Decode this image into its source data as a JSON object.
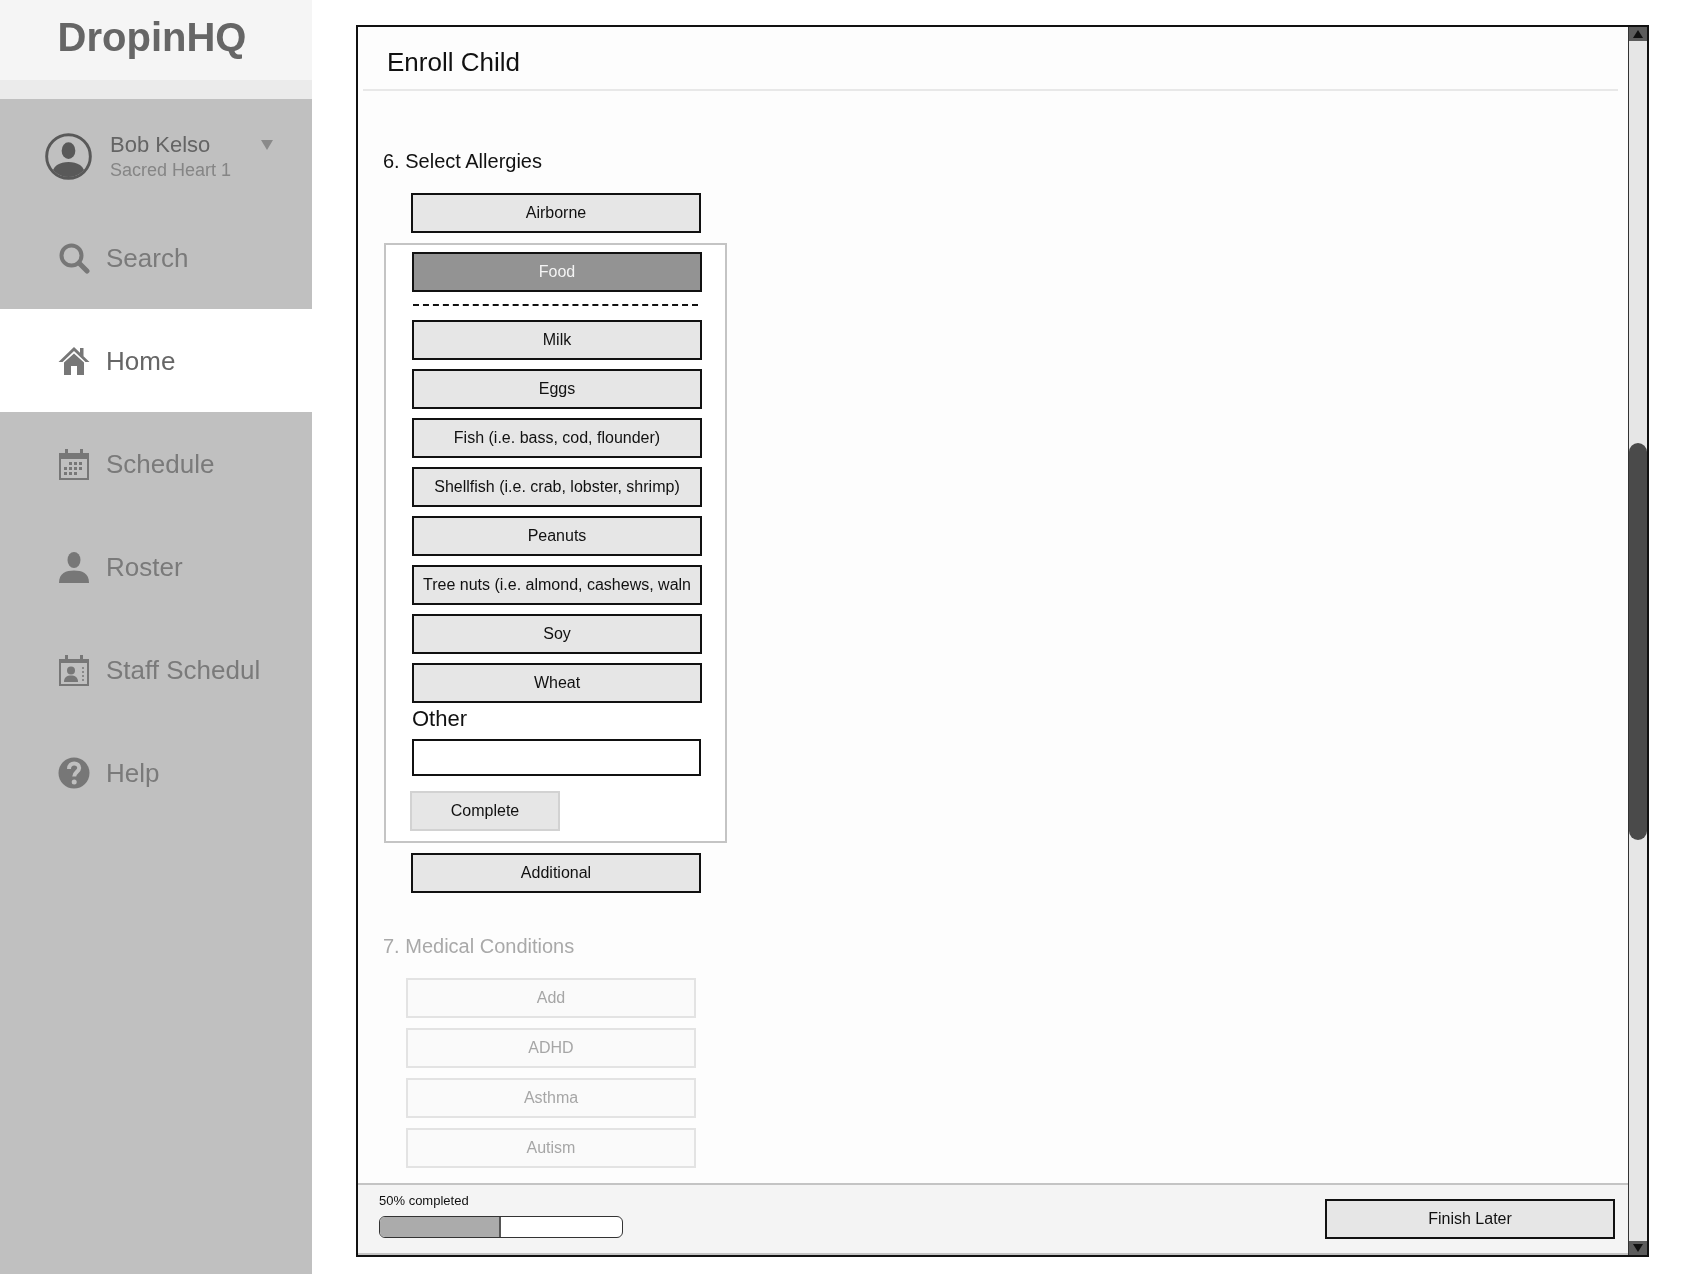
{
  "sidebar": {
    "logo": "DropinHQ",
    "user": {
      "name": "Bob Kelso",
      "location": "Sacred Heart 1"
    },
    "nav": [
      {
        "label": "Search",
        "kind": "search",
        "selected": false
      },
      {
        "label": "Home",
        "kind": "home",
        "selected": true
      },
      {
        "label": "Schedule",
        "kind": "calendar",
        "selected": false
      },
      {
        "label": "Roster",
        "kind": "person",
        "selected": false
      },
      {
        "label": "Staff Schedul",
        "kind": "staff",
        "selected": false
      },
      {
        "label": "Help",
        "kind": "help",
        "selected": false
      }
    ]
  },
  "form": {
    "title": "Enroll Child",
    "sections": [
      {
        "heading": "6. Select Allergies",
        "disabled": false,
        "items": [
          {
            "kind": "category",
            "label": "Airborne",
            "expanded": false
          },
          {
            "kind": "category",
            "label": "Food",
            "expanded": true,
            "options": [
              {
                "label": "Milk",
                "selected": false
              },
              {
                "label": "Eggs",
                "selected": false
              },
              {
                "label": "Fish (i.e. bass, cod, flounder)",
                "selected": false
              },
              {
                "label": "Shellfish (i.e. crab, lobster, shrimp)",
                "selected": false
              },
              {
                "label": "Peanuts",
                "selected": false
              },
              {
                "label": "Tree nuts (i.e. almond, cashews, waln",
                "selected": false
              },
              {
                "label": "Soy",
                "selected": false
              },
              {
                "label": "Wheat",
                "selected": false
              }
            ],
            "other": {
              "label": "Other"
            },
            "submit": "Complete"
          },
          {
            "kind": "category",
            "label": "Additional",
            "expanded": false
          }
        ]
      },
      {
        "heading": "7. Medical Conditions",
        "disabled": true,
        "items": [
          {
            "kind": "button",
            "label": "Add"
          },
          {
            "kind": "button",
            "label": "ADHD"
          },
          {
            "kind": "button",
            "label": "Asthma"
          },
          {
            "kind": "button",
            "label": "Autism"
          }
        ]
      }
    ]
  },
  "footer": {
    "progress": {
      "label": "50% completed",
      "level": 0.5
    },
    "finish_button": "Finish Later"
  }
}
